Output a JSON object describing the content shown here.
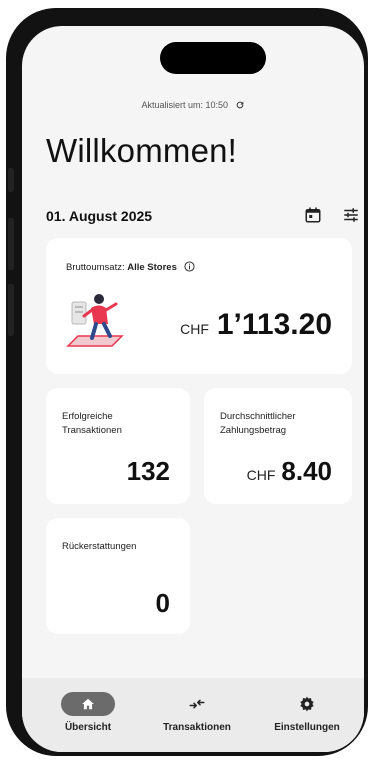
{
  "status": {
    "updated_text": "Aktualisiert um: 10:50"
  },
  "header": {
    "title": "Willkommen!"
  },
  "date": {
    "label": "01. August 2025"
  },
  "gross": {
    "label_prefix": "Bruttoumsatz:",
    "label_store": "Alle Stores",
    "currency": "CHF",
    "amount": "1’113.20"
  },
  "stats": {
    "transactions": {
      "label_line1": "Erfolgreiche",
      "label_line2": "Transaktionen",
      "value": "132"
    },
    "average": {
      "label_line1": "Durchschnittlicher",
      "label_line2": "Zahlungsbetrag",
      "currency": "CHF",
      "value": "8.40"
    },
    "refunds": {
      "label": "Rückerstattungen",
      "value": "0"
    }
  },
  "nav": {
    "items": [
      {
        "label": "Übersicht",
        "icon": "home-icon",
        "active": true
      },
      {
        "label": "Transaktionen",
        "icon": "transactions-icon",
        "active": false
      },
      {
        "label": "Einstellungen",
        "icon": "gear-icon",
        "active": false
      }
    ]
  },
  "colors": {
    "accent": "#e8374f",
    "nav_active": "#6b6b6b",
    "background": "#f5f5f5"
  }
}
